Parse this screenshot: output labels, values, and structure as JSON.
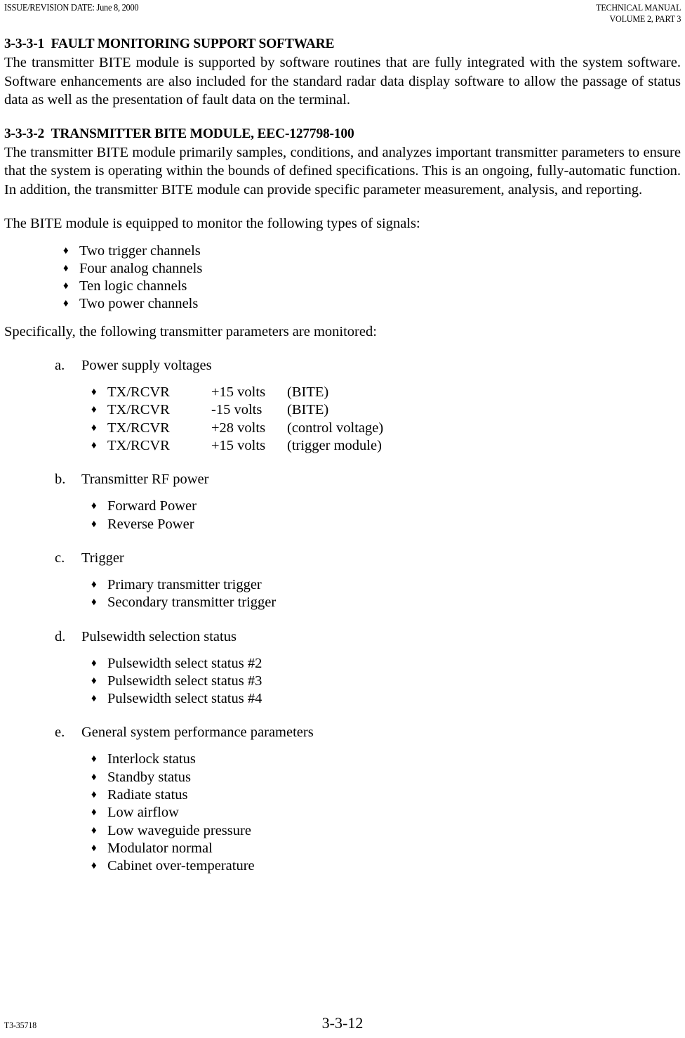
{
  "header": {
    "left": "ISSUE/REVISION DATE: June 8, 2000",
    "right_line1": "TECHNICAL MANUAL",
    "right_line2": "VOLUME 2, PART 3"
  },
  "sections": {
    "s1": {
      "number": "3-3-3-1",
      "title": "FAULT MONITORING SUPPORT SOFTWARE",
      "body": "The transmitter BITE module is supported by software routines that are fully integrated with the system software.  Software enhancements are also included for the standard radar data display software to allow the passage of status data as well as the presentation of fault data on the terminal."
    },
    "s2": {
      "number": "3-3-3-2",
      "title": "TRANSMITTER BITE MODULE, EEC-127798-100",
      "body": "The transmitter BITE module primarily samples, conditions, and analyzes important transmitter parameters to ensure that the system is operating within the bounds of defined specifications.  This is an ongoing, fully-automatic function.  In addition, the transmitter BITE module can provide specific parameter measurement, analysis, and reporting.",
      "intro_signals": "The BITE module is equipped to monitor the following types of signals:",
      "signal_types": [
        "Two trigger channels",
        "Four analog channels",
        "Ten logic channels",
        "Two power channels"
      ],
      "intro_parameters": "Specifically, the following transmitter parameters are monitored:",
      "parameters": [
        {
          "marker": "a.",
          "label": "Power supply voltages",
          "type": "voltage-table",
          "rows": [
            {
              "name": "TX/RCVR",
              "value": "+15 volts",
              "note": "(BITE)"
            },
            {
              "name": "TX/RCVR",
              "value": "-15 volts",
              "note": "(BITE)"
            },
            {
              "name": "TX/RCVR",
              "value": "+28 volts",
              "note": "(control voltage)"
            },
            {
              "name": "TX/RCVR",
              "value": "+15 volts",
              "note": "(trigger module)"
            }
          ]
        },
        {
          "marker": "b.",
          "label": "Transmitter RF power",
          "type": "list",
          "items": [
            "Forward Power",
            "Reverse Power"
          ]
        },
        {
          "marker": "c.",
          "label": "Trigger",
          "type": "list",
          "items": [
            "Primary transmitter trigger",
            "Secondary transmitter trigger"
          ]
        },
        {
          "marker": "d.",
          "label": "Pulsewidth selection status",
          "type": "list",
          "items": [
            "Pulsewidth select status #2",
            "Pulsewidth select status #3",
            "Pulsewidth select status #4"
          ]
        },
        {
          "marker": "e.",
          "label": "General system performance parameters",
          "type": "list",
          "items": [
            "Interlock status",
            "Standby status",
            "Radiate status",
            "Low airflow",
            "Low waveguide pressure",
            "Modulator normal",
            "Cabinet over-temperature"
          ]
        }
      ]
    }
  },
  "bullet_glyph": "♦",
  "footer": {
    "document_number": "T3-35718",
    "page_number": "3-3-12"
  }
}
